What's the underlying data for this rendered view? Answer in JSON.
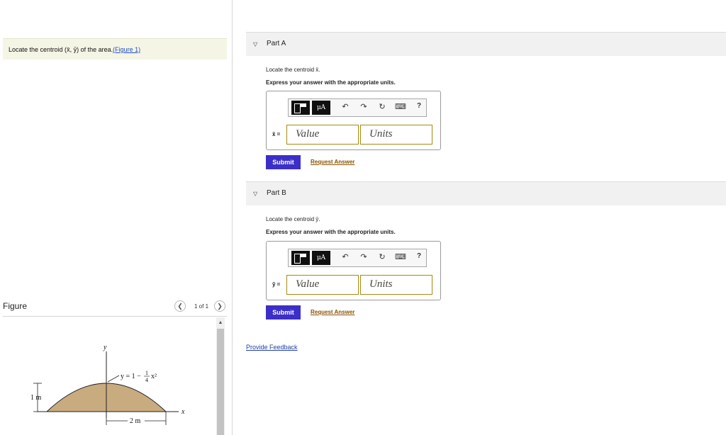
{
  "problem": {
    "prefix": "Locate the centroid (",
    "xbar": "x̄",
    "sep": ", ",
    "ybar": "ȳ",
    "suffix": ") of the area.",
    "figure_link": "(Figure 1)"
  },
  "figure_panel": {
    "title": "Figure",
    "pager": "1 of 1",
    "prev_icon": "chevron-left-icon",
    "next_icon": "chevron-right-icon",
    "diagram": {
      "y_axis": "y",
      "x_axis": "x",
      "equation": "y = 1 − ",
      "frac_num": "1",
      "frac_den": "4",
      "eq_tail": "x²",
      "height_dim": "1 m",
      "width_dim": "2 m"
    }
  },
  "partA": {
    "label": "Part A",
    "prompt": "Locate the centroid x̄.",
    "instruction": "Express your answer with the appropriate units.",
    "toolbar": {
      "template_icon": "template-icon",
      "units_button": "μA",
      "undo_icon": "undo-icon",
      "redo_icon": "redo-icon",
      "reset_icon": "reset-icon",
      "keyboard_icon": "keyboard-icon",
      "help": "?"
    },
    "var_label": "x̄ =",
    "value_placeholder": "Value",
    "units_placeholder": "Units",
    "submit": "Submit",
    "request": "Request Answer"
  },
  "partB": {
    "label": "Part B",
    "prompt": "Locate the centroid ȳ.",
    "instruction": "Express your answer with the appropriate units.",
    "toolbar": {
      "template_icon": "template-icon",
      "units_button": "μA",
      "undo_icon": "undo-icon",
      "redo_icon": "redo-icon",
      "reset_icon": "reset-icon",
      "keyboard_icon": "keyboard-icon",
      "help": "?"
    },
    "var_label": "ȳ =",
    "value_placeholder": "Value",
    "units_placeholder": "Units",
    "submit": "Submit",
    "request": "Request Answer"
  },
  "feedback": "Provide Feedback",
  "colors": {
    "submit_bg": "#3c2fc9",
    "field_border": "#a88a12",
    "area_fill": "#c9ab80",
    "link": "#1f4fbf"
  }
}
